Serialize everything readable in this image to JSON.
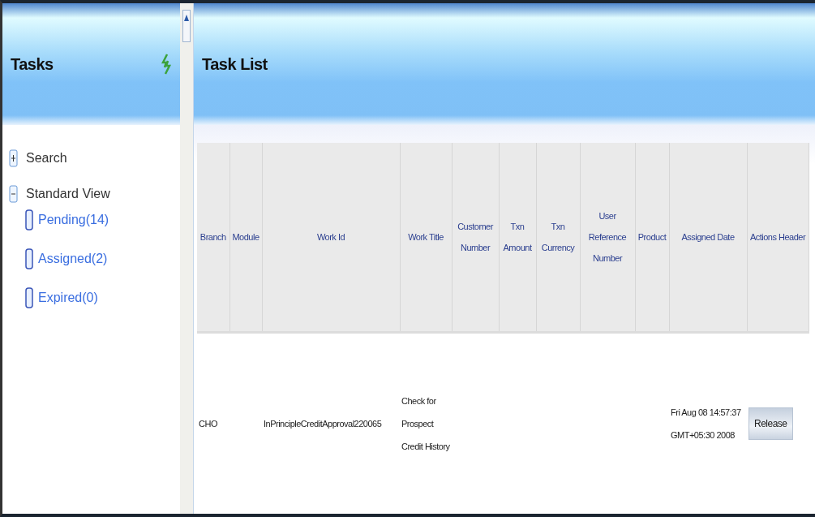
{
  "tasks_panel": {
    "title": "Tasks",
    "items": [
      {
        "label": "Search",
        "expanded": false
      },
      {
        "label": "Standard View",
        "expanded": true,
        "children": [
          {
            "label": "Pending(14)"
          },
          {
            "label": "Assigned(2)"
          },
          {
            "label": "Expired(0)"
          }
        ]
      }
    ]
  },
  "task_list": {
    "title": "Task List",
    "columns": [
      "Branch",
      "Module",
      "Work Id",
      "Work Title",
      "Customer Number",
      "Txn Amount",
      "Txn Currency",
      "User Reference Number",
      "Product",
      "Assigned Date",
      "Actions Header"
    ],
    "rows": [
      {
        "cells": [
          "CHO",
          "",
          "InPrincipleCreditApproval220065",
          "Check for Prospect Credit History",
          "",
          "",
          "",
          "",
          "",
          "Fri Aug 08 14:57:37 GMT+05:30 2008"
        ],
        "action": "Release"
      }
    ]
  }
}
